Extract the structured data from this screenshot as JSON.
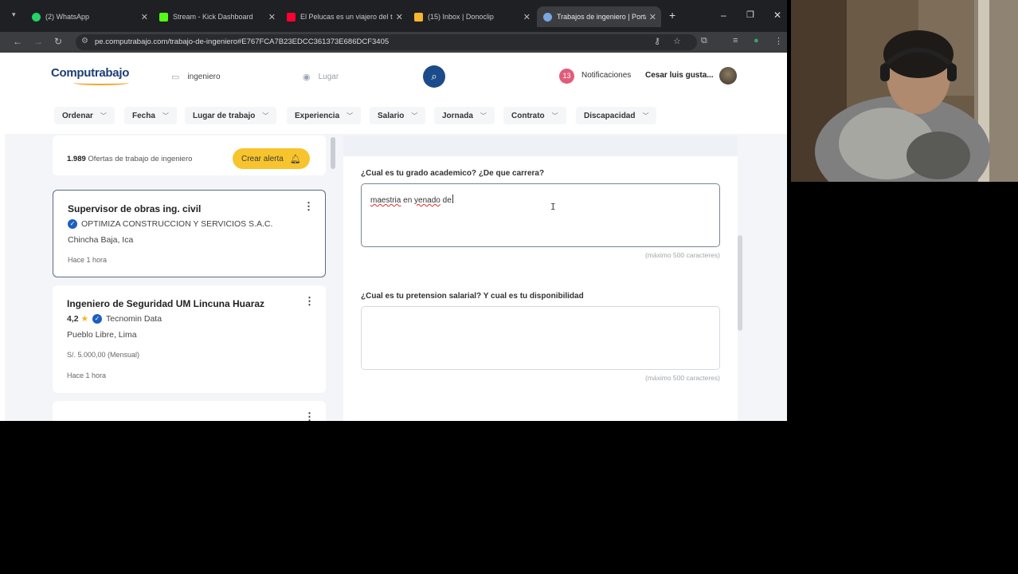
{
  "browser": {
    "tabs": [
      {
        "title": "(2) WhatsApp",
        "icon": "whatsapp-icon",
        "color": "#25d366"
      },
      {
        "title": "Stream - Kick Dashboard",
        "icon": "kick-icon",
        "color": "#53fc18"
      },
      {
        "title": "El Pelucas es un viajero del t",
        "icon": "youtube-icon",
        "color": "#ff0033"
      },
      {
        "title": "(15) Inbox | Donoclip",
        "icon": "donoclip-icon",
        "color": "#f5b52e"
      },
      {
        "title": "Trabajos de ingeniero | Portal",
        "icon": "computrabajo-icon",
        "color": "#1c4b8c"
      }
    ],
    "url": "pe.computrabajo.com/trabajo-de-ingeniero#E767FCA7B23EDCC361373E686DCF3405"
  },
  "header": {
    "logo": "Computrabajo",
    "search_value": "ingeniero",
    "location_placeholder": "Lugar",
    "notifications_count": "13",
    "notifications_label": "Notificaciones",
    "user_name": "Cesar luis gusta..."
  },
  "filters": [
    "Ordenar",
    "Fecha",
    "Lugar de trabajo",
    "Experiencia",
    "Salario",
    "Jornada",
    "Contrato",
    "Discapacidad"
  ],
  "results": {
    "count": "1.989",
    "count_label": "Ofertas de trabajo de ingeniero",
    "alert_button": "Crear alerta"
  },
  "jobs": [
    {
      "title": "Supervisor de obras ing. civil",
      "company": "OPTIMIZA CONSTRUCCION Y SERVICIOS S.A.C.",
      "location": "Chincha Baja, Ica",
      "time": "Hace 1 hora"
    },
    {
      "title": "Ingeniero de Seguridad UM Lincuna Huaraz",
      "rating": "4,2",
      "company": "Tecnomin Data",
      "location": "Pueblo Libre, Lima",
      "salary": "S/. 5.000,00 (Mensual)",
      "time": "Hace 1 hora"
    }
  ],
  "questions": [
    {
      "label": "¿Cual es tu grado academico? ¿De que carrera?",
      "answer_word1": "maestria",
      "answer_mid": " en ",
      "answer_word2": "yenado",
      "answer_end": " de",
      "hint": "(máximo 500 caracteres)"
    },
    {
      "label": "¿Cual es tu pretension salarial? Y cual es tu disponibilidad",
      "answer": "",
      "hint": "(máximo 500 caracteres)"
    }
  ]
}
